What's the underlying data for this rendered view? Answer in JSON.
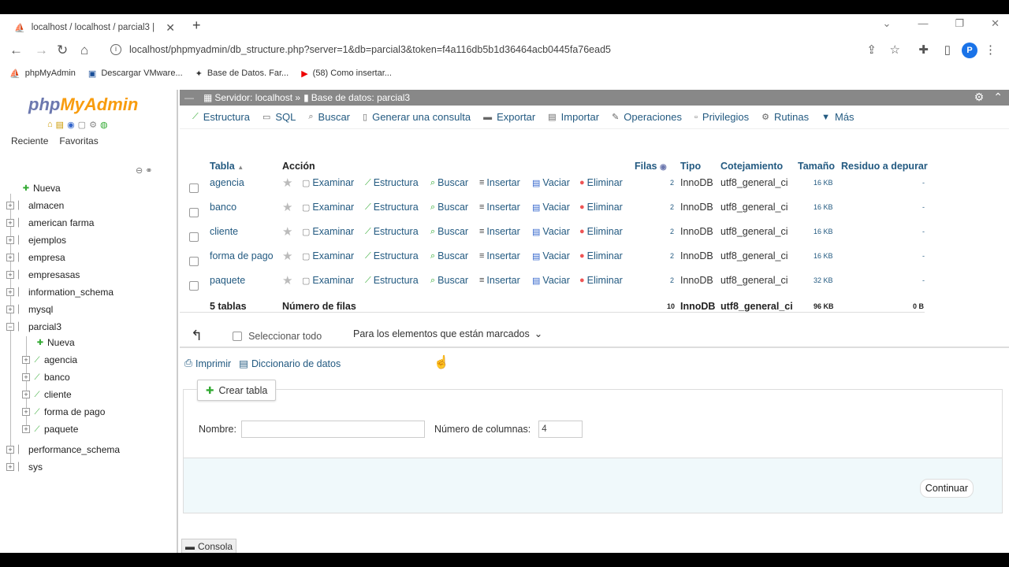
{
  "browser": {
    "tab_title": "localhost / localhost / parcial3 |",
    "new_tab": "+",
    "url": "localhost/phpmyadmin/db_structure.php?server=1&db=parcial3&token=f4a116db5b1d36464acb0445fa76ead5",
    "profile_initial": "P",
    "bookmarks": [
      {
        "label": "phpMyAdmin",
        "icon": "pma-icon"
      },
      {
        "label": "Descargar VMware...",
        "icon": "vmware-icon"
      },
      {
        "label": "Base de Datos. Far...",
        "icon": "db-icon"
      },
      {
        "label": "(58) Como insertar...",
        "icon": "youtube-icon"
      }
    ]
  },
  "left": {
    "logo_php": "php",
    "logo_myadmin": "MyAdmin",
    "recent": "Reciente",
    "favorites": "Favoritas",
    "tree": [
      {
        "label": "Nueva",
        "level": 0,
        "new": true
      },
      {
        "label": "almacen",
        "level": 0
      },
      {
        "label": "american farma",
        "level": 0
      },
      {
        "label": "ejemplos",
        "level": 0
      },
      {
        "label": "empresa",
        "level": 0
      },
      {
        "label": "empresasas",
        "level": 0
      },
      {
        "label": "information_schema",
        "level": 0
      },
      {
        "label": "mysql",
        "level": 0
      },
      {
        "label": "parcial3",
        "level": 0,
        "expanded": true
      },
      {
        "label": "Nueva",
        "level": 1,
        "new": true
      },
      {
        "label": "agencia",
        "level": 1
      },
      {
        "label": "banco",
        "level": 1
      },
      {
        "label": "cliente",
        "level": 1
      },
      {
        "label": "forma de pago",
        "level": 1
      },
      {
        "label": "paquete",
        "level": 1
      },
      {
        "label": "performance_schema",
        "level": 0
      },
      {
        "label": "sys",
        "level": 0
      }
    ]
  },
  "breadcrumb": {
    "server": "Servidor: localhost »",
    "database": "Base de datos: parcial3"
  },
  "menu": [
    {
      "label": "Estructura",
      "icon": "structure-icon"
    },
    {
      "label": "SQL",
      "icon": "sql-icon"
    },
    {
      "label": "Buscar",
      "icon": "search-icon"
    },
    {
      "label": "Generar una consulta",
      "icon": "query-icon"
    },
    {
      "label": "Exportar",
      "icon": "export-icon"
    },
    {
      "label": "Importar",
      "icon": "import-icon"
    },
    {
      "label": "Operaciones",
      "icon": "wrench-icon"
    },
    {
      "label": "Privilegios",
      "icon": "privileges-icon"
    },
    {
      "label": "Rutinas",
      "icon": "routines-icon"
    },
    {
      "label": "Más",
      "icon": "chevron-down-icon"
    }
  ],
  "table": {
    "headers": {
      "tabla": "Tabla",
      "accion": "Acción",
      "filas": "Filas",
      "tipo": "Tipo",
      "cotejamiento": "Cotejamiento",
      "tamano": "Tamaño",
      "residuo": "Residuo a depurar"
    },
    "actions": [
      "Examinar",
      "Estructura",
      "Buscar",
      "Insertar",
      "Vaciar",
      "Eliminar"
    ],
    "rows": [
      {
        "name": "agencia",
        "rows": "2",
        "type": "InnoDB",
        "collation": "utf8_general_ci",
        "size": "16 KB",
        "overhead": "-"
      },
      {
        "name": "banco",
        "rows": "2",
        "type": "InnoDB",
        "collation": "utf8_general_ci",
        "size": "16 KB",
        "overhead": "-"
      },
      {
        "name": "cliente",
        "rows": "2",
        "type": "InnoDB",
        "collation": "utf8_general_ci",
        "size": "16 KB",
        "overhead": "-"
      },
      {
        "name": "forma de pago",
        "rows": "2",
        "type": "InnoDB",
        "collation": "utf8_general_ci",
        "size": "16 KB",
        "overhead": "-"
      },
      {
        "name": "paquete",
        "rows": "2",
        "type": "InnoDB",
        "collation": "utf8_general_ci",
        "size": "32 KB",
        "overhead": "-"
      }
    ],
    "summary": {
      "count": "5 tablas",
      "label": "Número de filas",
      "rows": "10",
      "type": "InnoDB",
      "collation": "utf8_general_ci",
      "size": "96 KB",
      "overhead": "0 B"
    }
  },
  "bulk": {
    "select_all": "Seleccionar todo",
    "with_selected": "Para los elementos que están marcados"
  },
  "links": {
    "print": "Imprimir",
    "dictionary": "Diccionario de datos"
  },
  "create": {
    "legend": "Crear tabla",
    "name_label": "Nombre:",
    "name_value": "",
    "columns_label": "Número de columnas:",
    "columns_value": "4",
    "continue": "Continuar"
  },
  "console": "Consola"
}
